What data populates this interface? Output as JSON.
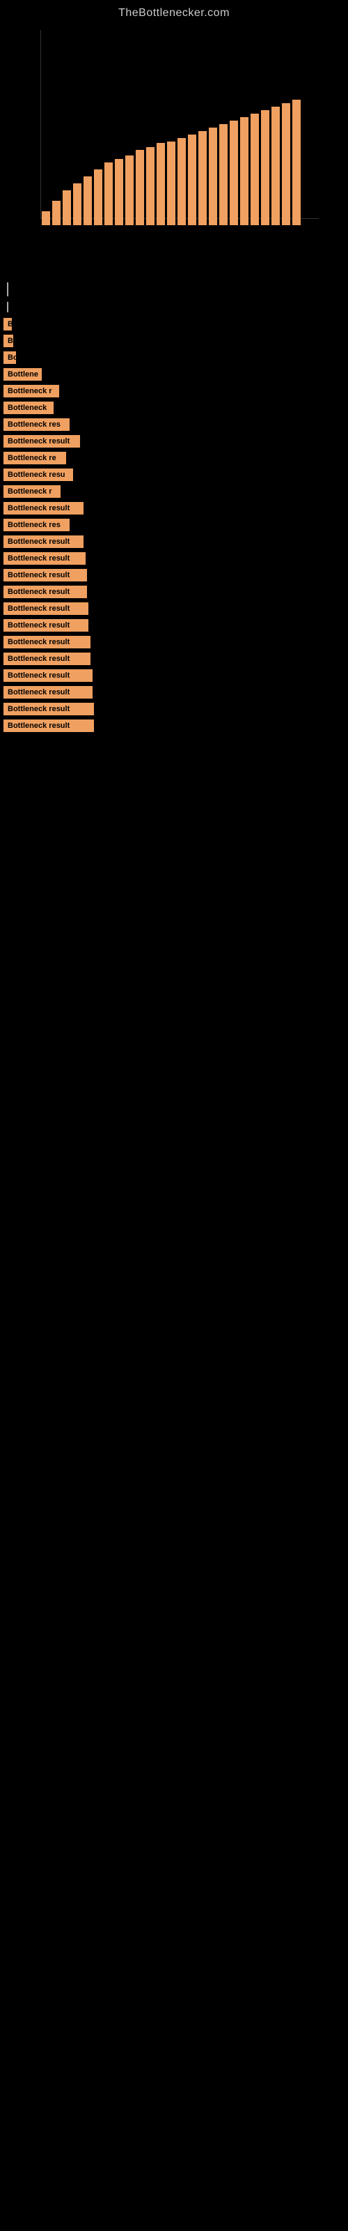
{
  "site": {
    "title": "TheBottlenecker.com"
  },
  "chart": {
    "visible": true
  },
  "results": [
    {
      "id": 1,
      "label": "B",
      "width": 12
    },
    {
      "id": 2,
      "label": "B",
      "width": 14
    },
    {
      "id": 3,
      "label": "Bo",
      "width": 18
    },
    {
      "id": 4,
      "label": "Bottlene",
      "width": 55
    },
    {
      "id": 5,
      "label": "Bottleneck r",
      "width": 80
    },
    {
      "id": 6,
      "label": "Bottleneck",
      "width": 72
    },
    {
      "id": 7,
      "label": "Bottleneck res",
      "width": 95
    },
    {
      "id": 8,
      "label": "Bottleneck result",
      "width": 110
    },
    {
      "id": 9,
      "label": "Bottleneck re",
      "width": 90
    },
    {
      "id": 10,
      "label": "Bottleneck resu",
      "width": 100
    },
    {
      "id": 11,
      "label": "Bottleneck r",
      "width": 82
    },
    {
      "id": 12,
      "label": "Bottleneck result",
      "width": 115
    },
    {
      "id": 13,
      "label": "Bottleneck res",
      "width": 95
    },
    {
      "id": 14,
      "label": "Bottleneck result",
      "width": 115
    },
    {
      "id": 15,
      "label": "Bottleneck result",
      "width": 118
    },
    {
      "id": 16,
      "label": "Bottleneck result",
      "width": 120
    },
    {
      "id": 17,
      "label": "Bottleneck result",
      "width": 120
    },
    {
      "id": 18,
      "label": "Bottleneck result",
      "width": 122
    },
    {
      "id": 19,
      "label": "Bottleneck result",
      "width": 122
    },
    {
      "id": 20,
      "label": "Bottleneck result",
      "width": 125
    },
    {
      "id": 21,
      "label": "Bottleneck result",
      "width": 125
    },
    {
      "id": 22,
      "label": "Bottleneck result",
      "width": 128
    },
    {
      "id": 23,
      "label": "Bottleneck result",
      "width": 128
    },
    {
      "id": 24,
      "label": "Bottleneck result",
      "width": 130
    },
    {
      "id": 25,
      "label": "Bottleneck result",
      "width": 130
    }
  ],
  "colors": {
    "background": "#000000",
    "bar": "#f0a060",
    "text": "#cccccc",
    "bar_text": "#000000"
  }
}
